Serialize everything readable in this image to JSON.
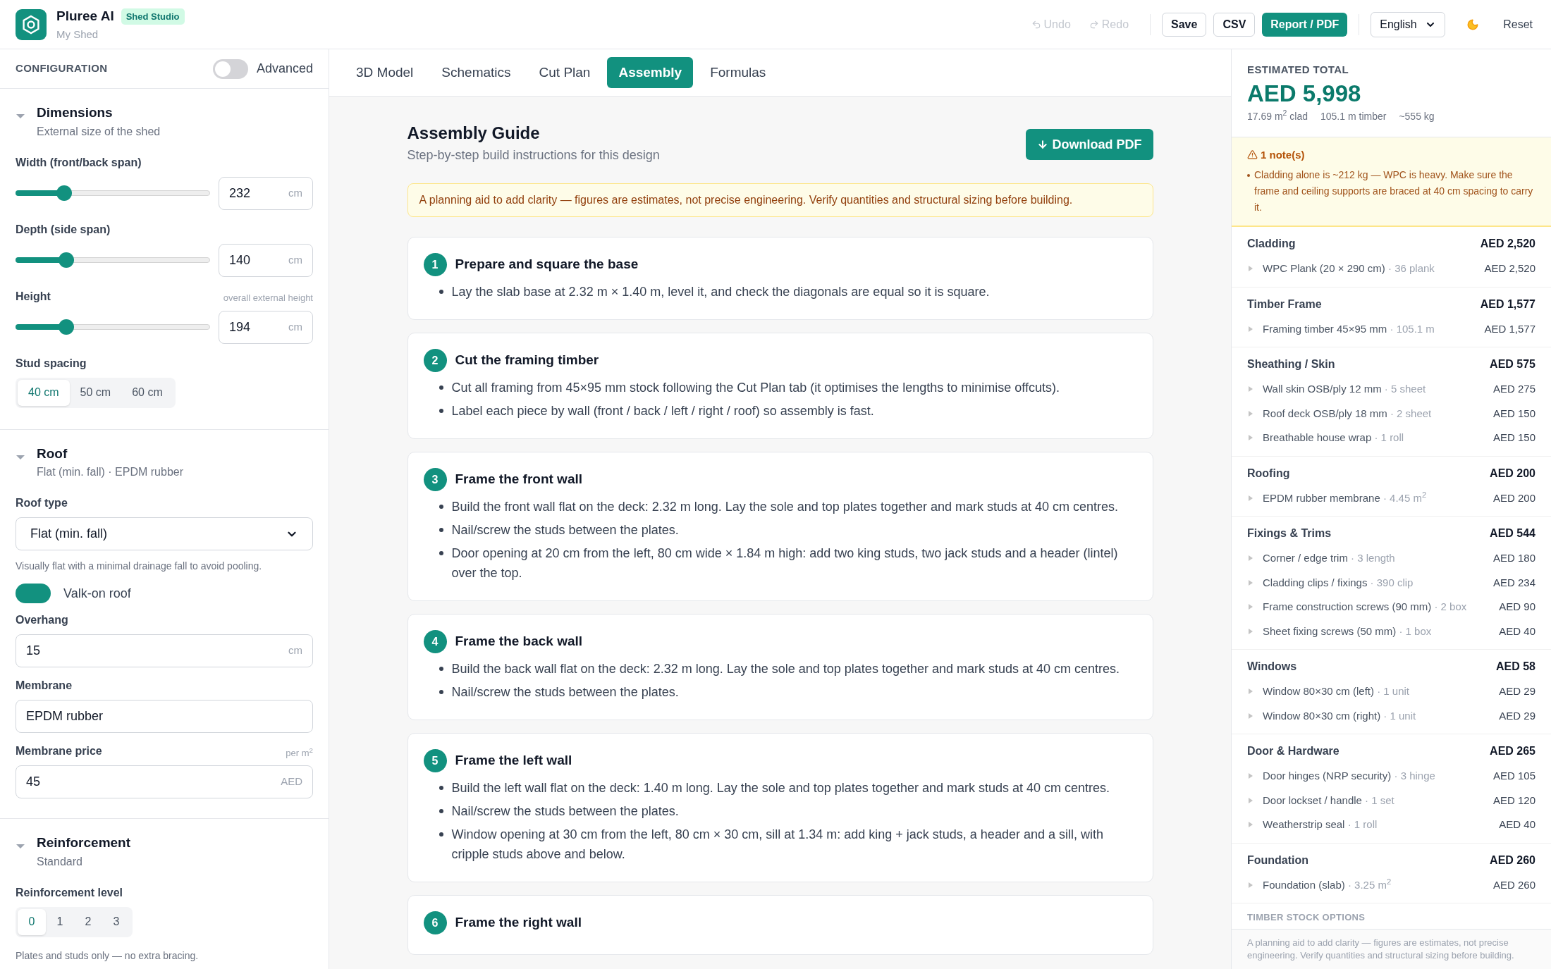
{
  "header": {
    "app_name": "Pluree AI",
    "badge": "Shed Studio",
    "project": "My Shed",
    "actions": [
      {
        "kind": "ghost",
        "label": "Undo",
        "disabled": true
      },
      {
        "kind": "ghost",
        "label": "Redo",
        "disabled": true
      },
      {
        "kind": "outline",
        "label": "Save",
        "disabled": false
      },
      {
        "kind": "outline",
        "label": "CSV",
        "disabled": false
      },
      {
        "kind": "primary",
        "label": "Report / PDF",
        "disabled": false
      }
    ],
    "language": "English",
    "reset": "Reset"
  },
  "sidebar": {
    "title": "CONFIGURATION",
    "advanced": {
      "label": "Advanced",
      "on": false
    },
    "sections": [
      {
        "title": "Dimensions",
        "subtitle": "External size of the shed",
        "expanded": true,
        "controls": [
          {
            "kind": "slider",
            "label": "Width (front/back span)",
            "level": 0.21,
            "value": "232",
            "unit": "cm"
          },
          {
            "kind": "slider",
            "label": "Depth (side span)",
            "level": 0.22,
            "value": "140",
            "unit": "cm"
          },
          {
            "kind": "slider",
            "label": "Height",
            "hint": "overall external height",
            "level": 0.22,
            "value": "194",
            "unit": "cm"
          },
          {
            "kind": "segmented",
            "label": "Stud spacing",
            "options": [
              {
                "label": "40 cm",
                "selected": true
              },
              {
                "label": "50 cm",
                "selected": false
              },
              {
                "label": "60 cm",
                "selected": false
              }
            ]
          }
        ]
      },
      {
        "title": "Roof",
        "subtitle": "Flat (min. fall) · EPDM rubber",
        "expanded": true,
        "controls": [
          {
            "kind": "select",
            "label": "Roof type",
            "value": "Flat (min. fall)"
          },
          {
            "kind": "note",
            "text": "Visually flat with a minimal drainage fall to avoid pooling."
          },
          {
            "kind": "toggle",
            "label": "Valk-on roof",
            "on": true
          },
          {
            "kind": "input",
            "label": "Overhang",
            "value": "15",
            "unit": "cm"
          },
          {
            "kind": "input",
            "label": "Membrane",
            "value": "EPDM rubber"
          },
          {
            "kind": "input",
            "label": "Membrane price",
            "hint": "per m$^{2}$",
            "value": "45",
            "unit": "AED"
          }
        ]
      },
      {
        "title": "Reinforcement",
        "subtitle": "Standard",
        "expanded": true,
        "controls": [
          {
            "kind": "segmented",
            "label": "Reinforcement level",
            "options": [
              {
                "label": "0",
                "selected": true
              },
              {
                "label": "1",
                "selected": false
              },
              {
                "label": "2",
                "selected": false
              },
              {
                "label": "3",
                "selected": false
              }
            ]
          },
          {
            "kind": "note",
            "text": "Plates and studs only — no extra bracing."
          }
        ]
      }
    ]
  },
  "tabs": [
    {
      "label": "3D Model",
      "selected": false
    },
    {
      "label": "Schematics",
      "selected": false
    },
    {
      "label": "Cut Plan",
      "selected": false
    },
    {
      "label": "Assembly",
      "selected": true
    },
    {
      "label": "Formulas",
      "selected": false
    }
  ],
  "guide": {
    "title": "Assembly Guide",
    "subtitle": "Step-by-step build instructions for this design",
    "download": "Download PDF",
    "notice": "A planning aid to add clarity — figures are estimates, not precise engineering. Verify quantities and structural sizing before building.",
    "steps": [
      {
        "number": "1",
        "title": "Prepare and square the base",
        "bullets": [
          "Lay the slab base at 2.32 m × 1.40 m, level it, and check the diagonals are equal so it is square."
        ]
      },
      {
        "number": "2",
        "title": "Cut the framing timber",
        "bullets": [
          "Cut all framing from 45×95 mm stock following the Cut Plan tab (it optimises the lengths to minimise offcuts).",
          "Label each piece by wall (front / back / left / right / roof) so assembly is fast."
        ]
      },
      {
        "number": "3",
        "title": "Frame the front wall",
        "bullets": [
          "Build the front wall flat on the deck: 2.32 m long. Lay the sole and top plates together and mark studs at 40 cm centres.",
          "Nail/screw the studs between the plates.",
          "Door opening at 20 cm from the left, 80 cm wide × 1.84 m high: add two king studs, two jack studs and a header (lintel) over the top."
        ]
      },
      {
        "number": "4",
        "title": "Frame the back wall",
        "bullets": [
          "Build the back wall flat on the deck: 2.32 m long. Lay the sole and top plates together and mark studs at 40 cm centres.",
          "Nail/screw the studs between the plates."
        ]
      },
      {
        "number": "5",
        "title": "Frame the left wall",
        "bullets": [
          "Build the left wall flat on the deck: 1.40 m long. Lay the sole and top plates together and mark studs at 40 cm centres.",
          "Nail/screw the studs between the plates.",
          "Window opening at 30 cm from the left, 80 cm × 30 cm, sill at 1.34 m: add king + jack studs, a header and a sill, with cripple studs above and below."
        ]
      },
      {
        "number": "6",
        "title": "Frame the right wall"
      }
    ]
  },
  "summary": {
    "label": "ESTIMATED TOTAL",
    "amount": "AED 5,998",
    "stats": [
      "17.69 m$^{2}$ clad",
      "105.1 m timber",
      "~555 kg"
    ],
    "notes": {
      "title": "1 note(s)",
      "items": [
        "Cladding alone is ~212 kg — WPC is heavy. Make sure the frame and ceiling supports are braced at 40 cm spacing to carry it."
      ]
    },
    "categories": [
      {
        "name": "Cladding",
        "total": "AED 2,520",
        "items": [
          {
            "name": "WPC Plank (20 × 290 cm)",
            "qty": "· 36 plank",
            "price": "AED 2,520"
          }
        ]
      },
      {
        "name": "Timber Frame",
        "total": "AED 1,577",
        "items": [
          {
            "name": "Framing timber 45×95 mm",
            "qty": "· 105.1 m",
            "price": "AED 1,577"
          }
        ]
      },
      {
        "name": "Sheathing / Skin",
        "total": "AED 575",
        "items": [
          {
            "name": "Wall skin OSB/ply 12 mm",
            "qty": "· 5 sheet",
            "price": "AED 275"
          },
          {
            "name": "Roof deck OSB/ply 18 mm",
            "qty": "· 2 sheet",
            "price": "AED 150"
          },
          {
            "name": "Breathable house wrap",
            "qty": "· 1 roll",
            "price": "AED 150"
          }
        ]
      },
      {
        "name": "Roofing",
        "total": "AED 200",
        "items": [
          {
            "name": "EPDM rubber membrane",
            "qty": "· 4.45 m$^{2}$",
            "price": "AED 200"
          }
        ]
      },
      {
        "name": "Fixings & Trims",
        "total": "AED 544",
        "items": [
          {
            "name": "Corner / edge trim",
            "qty": "· 3 length",
            "price": "AED 180"
          },
          {
            "name": "Cladding clips / fixings",
            "qty": "· 390 clip",
            "price": "AED 234"
          },
          {
            "name": "Frame construction screws (90 mm)",
            "qty": "· 2 box",
            "price": "AED 90"
          },
          {
            "name": "Sheet fixing screws (50 mm)",
            "qty": "· 1 box",
            "price": "AED 40"
          }
        ]
      },
      {
        "name": "Windows",
        "total": "AED 58",
        "items": [
          {
            "name": "Window 80×30 cm (left)",
            "qty": "· 1 unit",
            "price": "AED 29"
          },
          {
            "name": "Window 80×30 cm (right)",
            "qty": "· 1 unit",
            "price": "AED 29"
          }
        ]
      },
      {
        "name": "Door & Hardware",
        "total": "AED 265",
        "items": [
          {
            "name": "Door hinges (NRP security)",
            "qty": "· 3 hinge",
            "price": "AED 105"
          },
          {
            "name": "Door lockset / handle",
            "qty": "· 1 set",
            "price": "AED 120"
          },
          {
            "name": "Weatherstrip seal",
            "qty": "· 1 roll",
            "price": "AED 40"
          }
        ]
      },
      {
        "name": "Foundation",
        "total": "AED 260",
        "items": [
          {
            "name": "Foundation (slab)",
            "qty": "· 3.25 m$^{2}$",
            "price": "AED 260"
          }
        ]
      }
    ],
    "next_section": "TIMBER STOCK OPTIONS",
    "disclaimer": "A planning aid to add clarity — figures are estimates, not precise engineering. Verify quantities and structural sizing before building."
  }
}
